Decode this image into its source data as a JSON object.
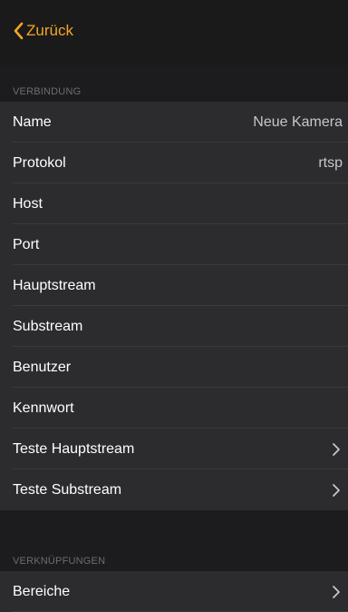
{
  "nav": {
    "back_label": "Zurück",
    "accent_color": "#f5a623",
    "back_icon": "chevron-left-icon"
  },
  "sections": {
    "connection": {
      "header": "VERBINDUNG",
      "rows": [
        {
          "label": "Name",
          "value": "Neue Kamera"
        },
        {
          "label": "Protokol",
          "value": "rtsp"
        },
        {
          "label": "Host",
          "value": ""
        },
        {
          "label": "Port",
          "value": ""
        },
        {
          "label": "Hauptstream",
          "value": ""
        },
        {
          "label": "Substream",
          "value": ""
        },
        {
          "label": "Benutzer",
          "value": ""
        },
        {
          "label": "Kennwort",
          "value": ""
        },
        {
          "label": "Teste Hauptstream",
          "disclosure": "chevron-right-icon"
        },
        {
          "label": "Teste Substream",
          "disclosure": "chevron-right-icon"
        }
      ]
    },
    "links": {
      "header": "VERKNÜPFUNGEN",
      "rows": [
        {
          "label": "Bereiche",
          "disclosure": "chevron-right-icon"
        }
      ]
    }
  }
}
